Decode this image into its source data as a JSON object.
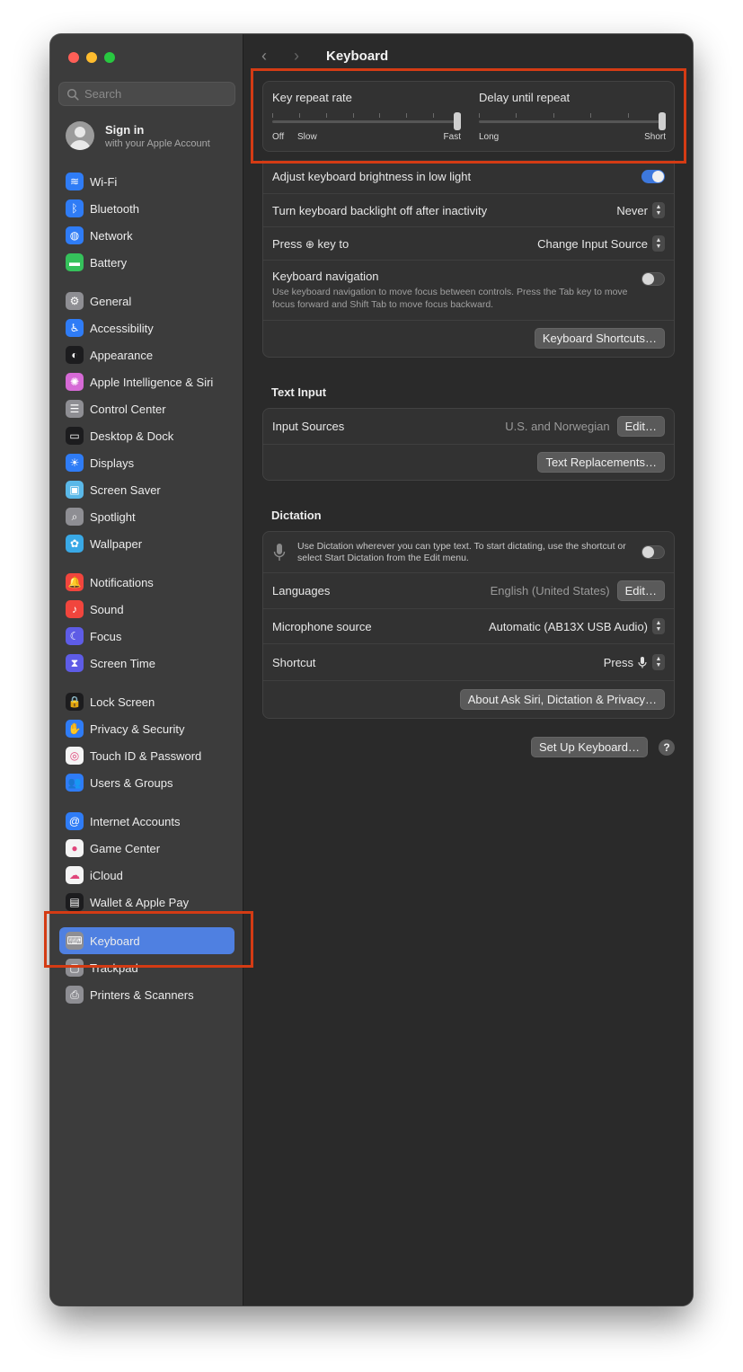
{
  "window": {
    "title": "Keyboard"
  },
  "search": {
    "placeholder": "Search"
  },
  "account": {
    "name": "Sign in",
    "subtitle": "with your Apple Account"
  },
  "sidebar": {
    "groups": [
      [
        {
          "label": "Wi-Fi",
          "icon": "wifi-icon",
          "color": "#2f7cf6"
        },
        {
          "label": "Bluetooth",
          "icon": "bluetooth-icon",
          "color": "#2f7cf6"
        },
        {
          "label": "Network",
          "icon": "globe-icon",
          "color": "#2f7cf6"
        },
        {
          "label": "Battery",
          "icon": "battery-icon",
          "color": "#35c15b"
        }
      ],
      [
        {
          "label": "General",
          "icon": "gear-icon",
          "color": "#8e8e93"
        },
        {
          "label": "Accessibility",
          "icon": "accessibility-icon",
          "color": "#2f7cf6"
        },
        {
          "label": "Appearance",
          "icon": "appearance-icon",
          "color": "#1c1c1e"
        },
        {
          "label": "Apple Intelligence & Siri",
          "icon": "siri-icon",
          "color": "#d66ad6"
        },
        {
          "label": "Control Center",
          "icon": "control-center-icon",
          "color": "#8e8e93"
        },
        {
          "label": "Desktop & Dock",
          "icon": "dock-icon",
          "color": "#1c1c1e"
        },
        {
          "label": "Displays",
          "icon": "displays-icon",
          "color": "#2f7cf6"
        },
        {
          "label": "Screen Saver",
          "icon": "screen-saver-icon",
          "color": "#5ab8e8"
        },
        {
          "label": "Spotlight",
          "icon": "magnifier-icon",
          "color": "#8e8e93"
        },
        {
          "label": "Wallpaper",
          "icon": "wallpaper-icon",
          "color": "#39a9e6"
        }
      ],
      [
        {
          "label": "Notifications",
          "icon": "bell-icon",
          "color": "#f1453d"
        },
        {
          "label": "Sound",
          "icon": "speaker-icon",
          "color": "#f1453d"
        },
        {
          "label": "Focus",
          "icon": "moon-icon",
          "color": "#5e5ce6"
        },
        {
          "label": "Screen Time",
          "icon": "hourglass-icon",
          "color": "#5e5ce6"
        }
      ],
      [
        {
          "label": "Lock Screen",
          "icon": "lock-icon",
          "color": "#1c1c1e"
        },
        {
          "label": "Privacy & Security",
          "icon": "hand-icon",
          "color": "#2f7cf6"
        },
        {
          "label": "Touch ID & Password",
          "icon": "fingerprint-icon",
          "color": "#f4f4f4"
        },
        {
          "label": "Users & Groups",
          "icon": "users-icon",
          "color": "#2f7cf6"
        }
      ],
      [
        {
          "label": "Internet Accounts",
          "icon": "at-icon",
          "color": "#2f7cf6"
        },
        {
          "label": "Game Center",
          "icon": "game-center-icon",
          "color": "#f4f4f4"
        },
        {
          "label": "iCloud",
          "icon": "cloud-icon",
          "color": "#f4f4f4"
        },
        {
          "label": "Wallet & Apple Pay",
          "icon": "wallet-icon",
          "color": "#1c1c1e"
        }
      ],
      [
        {
          "label": "Keyboard",
          "icon": "keyboard-icon",
          "color": "#8e8e93",
          "active": true
        },
        {
          "label": "Trackpad",
          "icon": "trackpad-icon",
          "color": "#8e8e93"
        },
        {
          "label": "Printers & Scanners",
          "icon": "printer-icon",
          "color": "#8e8e93"
        }
      ]
    ]
  },
  "repeat": {
    "key_repeat_label": "Key repeat rate",
    "key_repeat_off": "Off",
    "key_repeat_slow": "Slow",
    "key_repeat_fast": "Fast",
    "key_repeat_value": 1.0,
    "delay_label": "Delay until repeat",
    "delay_long": "Long",
    "delay_short": "Short",
    "delay_value": 1.0
  },
  "keyboard": {
    "brightness_label": "Adjust keyboard brightness in low light",
    "brightness_on": true,
    "backlight_label": "Turn keyboard backlight off after inactivity",
    "backlight_value": "Never",
    "press_label_prefix": "Press",
    "press_label_suffix": "key to",
    "press_value": "Change Input Source",
    "nav_label": "Keyboard navigation",
    "nav_desc": "Use keyboard navigation to move focus between controls. Press the Tab key to move focus forward and Shift Tab to move focus backward.",
    "nav_on": false,
    "shortcuts_button": "Keyboard Shortcuts…"
  },
  "text_input": {
    "title": "Text Input",
    "sources_label": "Input Sources",
    "sources_value": "U.S. and Norwegian",
    "edit_button": "Edit…",
    "replacements_button": "Text Replacements…"
  },
  "dictation": {
    "title": "Dictation",
    "desc": "Use Dictation wherever you can type text. To start dictating, use the shortcut or select Start Dictation from the Edit menu.",
    "enabled": false,
    "languages_label": "Languages",
    "languages_value": "English (United States)",
    "edit_button": "Edit…",
    "mic_label": "Microphone source",
    "mic_value": "Automatic (AB13X USB Audio)",
    "shortcut_label": "Shortcut",
    "shortcut_value": "Press",
    "about_button": "About Ask Siri, Dictation & Privacy…"
  },
  "footer": {
    "setup_button": "Set Up Keyboard…",
    "help": "?"
  }
}
